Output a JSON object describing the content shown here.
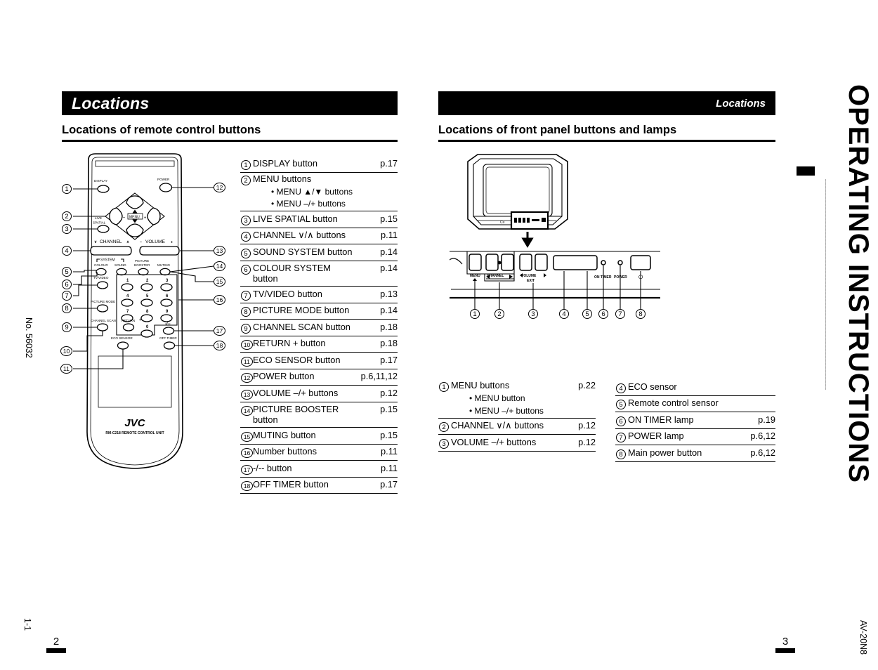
{
  "document": {
    "spine_title": "OPERATING INSTRUCTIONS",
    "model": "AV-20N8",
    "doc_number": "No. 56032",
    "sheet_number": "1-1",
    "page_left": "2",
    "page_right": "3"
  },
  "left_page": {
    "header_bar_title": "Locations",
    "section_title": "Locations of remote control buttons",
    "remote": {
      "brand": "JVC",
      "model_line": "RM-C218 REMOTE CONTROL UNIT",
      "labels": {
        "display": "DISPLAY",
        "power": "POWER",
        "menu": "MENU",
        "live_spatial_1": "LIVE",
        "live_spatial_2": "SPATIAL",
        "channel": "CHANNEL",
        "volume": "VOLUME",
        "system": "SYSTEM",
        "colour": "COLOUR",
        "sound": "SOUND",
        "picture": "PICTURE",
        "booster": "BOOSTER",
        "muting": "MUTING",
        "tv_video": "TV/VIDEO",
        "picture_mode": "PICTURE MODE",
        "channel_scan": "CHANNEL SCAN",
        "return": "RETURN",
        "eco_sensor": "ECO SENSOR",
        "off_timer": "OFF TIMER",
        "dash_slash": "-/--",
        "minus": "–",
        "plus": "+",
        "up_arrow": "▲",
        "down_arrow": "▼",
        "chan_down": "∨",
        "chan_up": "∧"
      },
      "keypad": [
        "1",
        "2",
        "3",
        "4",
        "5",
        "6",
        "7",
        "8",
        "9",
        "0"
      ],
      "callouts_left": [
        "1",
        "2",
        "3",
        "4",
        "5",
        "6",
        "7",
        "8",
        "9",
        "10",
        "11"
      ],
      "callouts_right": [
        "12",
        "13",
        "14",
        "15",
        "16",
        "17",
        "18"
      ]
    },
    "list": [
      {
        "num": "1",
        "label": "DISPLAY button",
        "page": "p.17"
      },
      {
        "num": "2",
        "label": "MENU buttons",
        "page": "",
        "subs": [
          "• MENU ▲/▼ buttons",
          "• MENU –/+ buttons"
        ]
      },
      {
        "num": "3",
        "label": "LIVE SPATIAL button",
        "page": "p.15"
      },
      {
        "num": "4",
        "label": "CHANNEL ∨/∧ buttons",
        "page": "p.11"
      },
      {
        "num": "5",
        "label": "SOUND SYSTEM button",
        "page": "p.14"
      },
      {
        "num": "6",
        "label": "COLOUR SYSTEM button",
        "page": "p.14"
      },
      {
        "num": "7",
        "label": "TV/VIDEO button",
        "page": "p.13"
      },
      {
        "num": "8",
        "label": "PICTURE MODE button",
        "page": "p.14"
      },
      {
        "num": "9",
        "label": "CHANNEL SCAN button",
        "page": "p.18"
      },
      {
        "num": "10",
        "label": "RETURN + button",
        "page": "p.18"
      },
      {
        "num": "11",
        "label": "ECO SENSOR button",
        "page": "p.17"
      },
      {
        "num": "12",
        "label": "POWER button",
        "page": "p.6,11,12"
      },
      {
        "num": "13",
        "label": "VOLUME –/+ buttons",
        "page": "p.12"
      },
      {
        "num": "14",
        "label": "PICTURE BOOSTER button",
        "page": "p.15"
      },
      {
        "num": "15",
        "label": "MUTING button",
        "page": "p.15"
      },
      {
        "num": "16",
        "label": "Number buttons",
        "page": "p.11"
      },
      {
        "num": "17",
        "label": "-/-- button",
        "page": "p.11"
      },
      {
        "num": "18",
        "label": "OFF TIMER button",
        "page": "p.17"
      }
    ]
  },
  "right_page": {
    "header_bar_title": "Locations",
    "section_title": "Locations of front panel buttons and lamps",
    "front_panel": {
      "labels": {
        "menu": "MENU",
        "channel": "CHANNEL",
        "volume": "VOLUME",
        "exit": "EXIT",
        "on_timer": "ON TIMER",
        "power": "POWER",
        "power_symbol": "⏻"
      },
      "callouts": [
        "1",
        "2",
        "3",
        "4",
        "5",
        "6",
        "7",
        "8"
      ]
    },
    "list_left": [
      {
        "num": "1",
        "label": "MENU buttons",
        "page": "p.22",
        "subs": [
          "• MENU button",
          "• MENU –/+ buttons"
        ]
      },
      {
        "num": "2",
        "label": "CHANNEL ∨/∧ buttons",
        "page": "p.12"
      },
      {
        "num": "3",
        "label": "VOLUME –/+ buttons",
        "page": "p.12"
      }
    ],
    "list_right": [
      {
        "num": "4",
        "label": "ECO sensor",
        "page": ""
      },
      {
        "num": "5",
        "label": "Remote control sensor",
        "page": ""
      },
      {
        "num": "6",
        "label": "ON TIMER lamp",
        "page": "p.19"
      },
      {
        "num": "7",
        "label": "POWER lamp",
        "page": "p.6,12"
      },
      {
        "num": "8",
        "label": "Main power button",
        "page": "p.6,12"
      }
    ]
  }
}
